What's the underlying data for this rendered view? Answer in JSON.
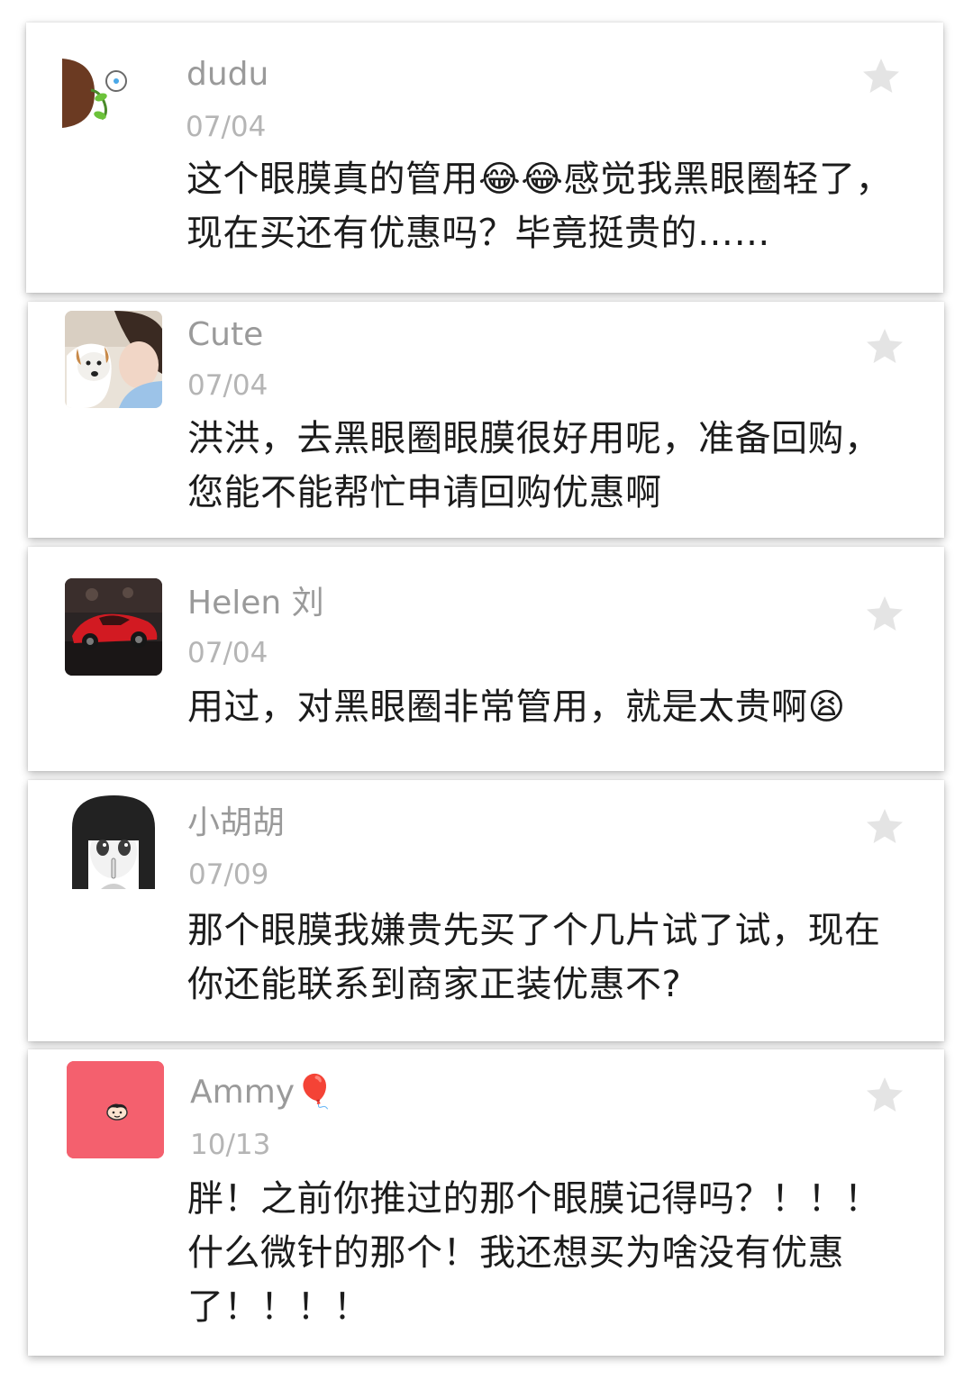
{
  "comments": [
    {
      "name": "dudu",
      "date": "07/04",
      "text": "这个眼膜真的管用😂😂感觉我黑眼圈轻了，现在买还有优惠吗？毕竟挺贵的……",
      "avatar_icon": "plant-sprout-icon"
    },
    {
      "name": "Cute",
      "date": "07/04",
      "text": "洪洪，去黑眼圈眼膜很好用呢，准备回购，您能不能帮忙申请回购优惠啊",
      "avatar_icon": "girl-with-dog-photo"
    },
    {
      "name": "Helen 刘",
      "date": "07/04",
      "text": "用过，对黑眼圈非常管用，就是太贵啊😫",
      "avatar_icon": "red-sports-car-photo"
    },
    {
      "name": "小胡胡",
      "date": "07/09",
      "text": "那个眼膜我嫌贵先买了个几片试了试，现在你还能联系到商家正装优惠不?",
      "avatar_icon": "manga-girl-icon"
    },
    {
      "name": "Ammy🎈",
      "date": "10/13",
      "text": "胖！之前你推过的那个眼膜记得吗？！！！什么微针的那个！我还想买为啥没有优惠了！！！！",
      "avatar_icon": "cartoon-face-icon"
    }
  ],
  "colors": {
    "name": "#9a9a9a",
    "date": "#b5b5b5",
    "text": "#1c1c1c",
    "star": "#e4e4e4",
    "ammy_avatar_bg": "#f4606e"
  }
}
